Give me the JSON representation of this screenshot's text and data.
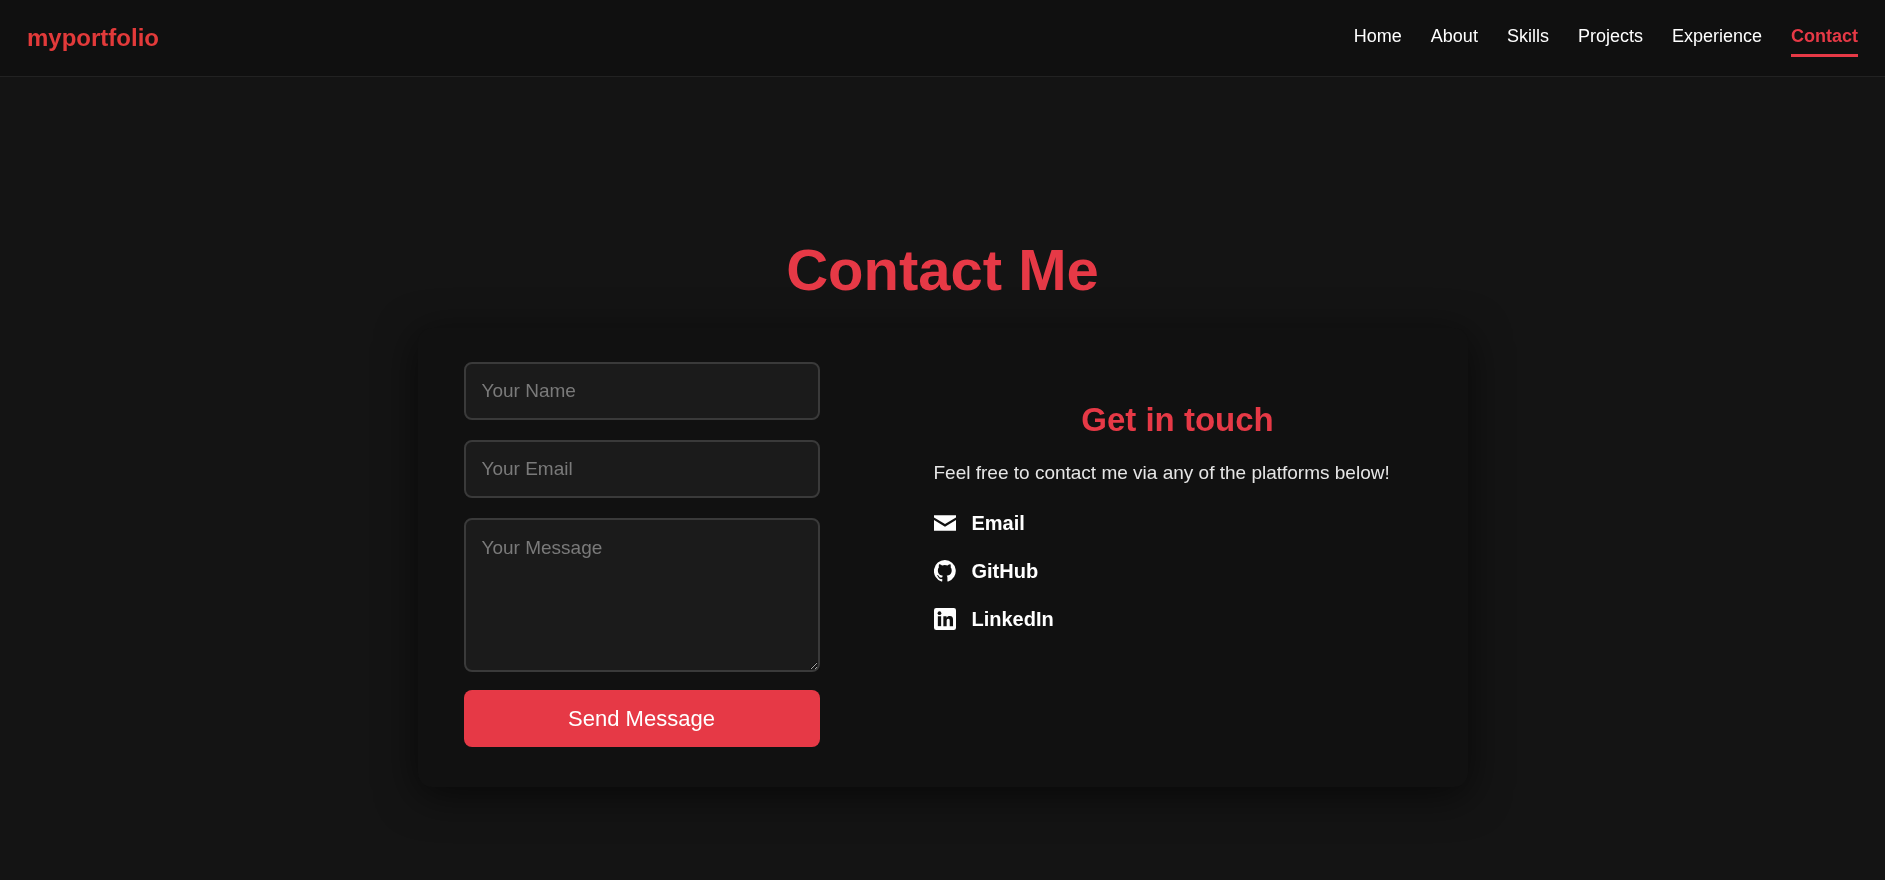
{
  "navbar": {
    "brand": "myportfolio",
    "links": [
      {
        "label": "Home",
        "selected": false
      },
      {
        "label": "About",
        "selected": false
      },
      {
        "label": "Skills",
        "selected": false
      },
      {
        "label": "Projects",
        "selected": false
      },
      {
        "label": "Experience",
        "selected": false
      },
      {
        "label": "Contact",
        "selected": true
      }
    ]
  },
  "contact": {
    "title": "Contact Me",
    "form": {
      "name": {
        "placeholder": "Your Name"
      },
      "email": {
        "placeholder": "Your Email"
      },
      "message": {
        "placeholder": "Your Message"
      },
      "submit": "Send Message"
    },
    "info": {
      "heading": "Get in touch",
      "text": "Feel free to contact me via any of the platforms below!",
      "links": [
        {
          "kind": "email",
          "label": "Email"
        },
        {
          "kind": "github",
          "label": "GitHub"
        },
        {
          "kind": "linkedin",
          "label": "LinkedIn"
        }
      ]
    }
  }
}
